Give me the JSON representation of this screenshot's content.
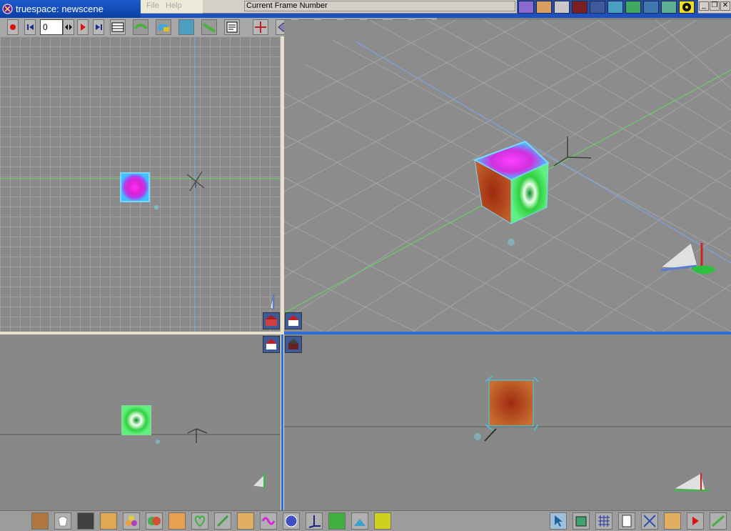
{
  "window": {
    "title": "truespace: newscene"
  },
  "menubar": {
    "items": [
      "File",
      "Help"
    ]
  },
  "status": {
    "field_label": "Current Frame Number"
  },
  "animation": {
    "current_frame": "0"
  },
  "colors": {
    "title_bar": "#0b3fa8",
    "viewport_bg": "#8a8a8a",
    "grid_line": "#a0a0a0",
    "splitter": "#e8e0cc",
    "active_border": "#2c6cd8",
    "x_axis": "#62d862",
    "z_axis": "#7aa8f0"
  },
  "viewports": [
    {
      "name": "top",
      "object_texture": "magenta"
    },
    {
      "name": "perspective",
      "object_texture": "mixed"
    },
    {
      "name": "front",
      "object_texture": "green"
    },
    {
      "name": "side",
      "object_texture": "brown"
    }
  ],
  "toolbars": {
    "animation": [
      "record-icon",
      "rewind-icon",
      "frame-input",
      "keyframe-icon",
      "play-icon",
      "end-icon",
      "timeline-icon",
      "path-icon",
      "bone-icon",
      "scene-editor-icon",
      "spline-icon",
      "script-icon",
      "move-icon",
      "rotate-icon",
      "scale-icon",
      "deform-icon",
      "twist-icon",
      "axes-icon",
      "up-icon",
      "down-icon"
    ],
    "top_right": [
      "render-icon",
      "object-icon",
      "layout-icon",
      "house-icon",
      "photo-icon",
      "mesh-icon",
      "axis-icon",
      "pipe-icon",
      "checker-icon",
      "radiation-icon"
    ],
    "bottom_left": [
      "cube-icon",
      "tooth-icon",
      "camera-icon",
      "wedge-icon",
      "balls-icon",
      "sphere-icon",
      "cone-icon",
      "heart-icon",
      "chain-icon",
      "palette-icon",
      "spiral-icon",
      "checker-ball-icon",
      "axes-icon",
      "grid-icon",
      "boolean-icon",
      "text3d-icon"
    ],
    "bottom_right": [
      "pointer-icon",
      "box-icon",
      "grid-icon",
      "page-icon",
      "wire-icon",
      "wedge-icon",
      "play-icon",
      "render-icon"
    ]
  }
}
